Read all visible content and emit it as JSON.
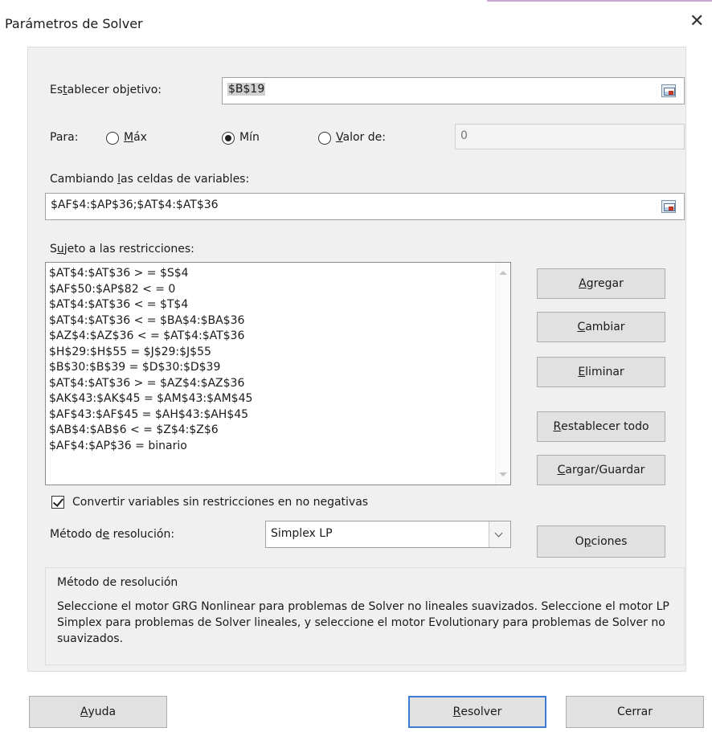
{
  "window": {
    "title": "Parámetros de Solver",
    "close_label": "✕"
  },
  "objective": {
    "label_pre": "Es",
    "label_accel": "t",
    "label_post": "ablecer objetivo:",
    "value": "$B$19"
  },
  "para": {
    "label": "Para:",
    "max": {
      "accel": "M",
      "rest": "áx",
      "selected": false
    },
    "min": {
      "label": "Mín",
      "selected": true
    },
    "value_of": {
      "accel": "V",
      "rest": "alor de:",
      "selected": false
    },
    "value_input": "0"
  },
  "variables": {
    "label_pre": "Cambiando ",
    "label_accel": "l",
    "label_post": "as celdas de variables:",
    "value": "$AF$4:$AP$36;$AT$4:$AT$36"
  },
  "constraints": {
    "label_pre": "S",
    "label_accel": "u",
    "label_post": "jeto a las restricciones:",
    "items": [
      "$AT$4:$AT$36 > = $S$4",
      "$AF$50:$AP$82 < = 0",
      "$AT$4:$AT$36 < = $T$4",
      "$AT$4:$AT$36 < = $BA$4:$BA$36",
      "$AZ$4:$AZ$36 < = $AT$4:$AT$36",
      "$H$29:$H$55 = $J$29:$J$55",
      "$B$30:$B$39 = $D$30:$D$39",
      "$AT$4:$AT$36 > = $AZ$4:$AZ$36",
      "$AK$43:$AK$45 = $AM$43:$AM$45",
      "$AF$43:$AF$45 = $AH$43:$AH$45",
      "$AB$4:$AB$6 < = $Z$4:$Z$6",
      "$AF$4:$AP$36 = binario"
    ]
  },
  "side_buttons": {
    "agregar": {
      "accel": "A",
      "rest": "gregar"
    },
    "cambiar": {
      "accel": "C",
      "rest": "ambiar"
    },
    "eliminar": {
      "accel": "E",
      "rest": "liminar"
    },
    "restablecer": {
      "accel": "R",
      "rest": "establecer todo"
    },
    "cargar": {
      "accel": "C",
      "rest": "argar/Guardar"
    }
  },
  "nonneg": {
    "checked": true,
    "label": "Convertir variables sin restricciones en no negativas"
  },
  "method": {
    "label_pre": "Método d",
    "label_accel": "e",
    "label_post": " resolución:",
    "value": "Simplex LP"
  },
  "options_button": {
    "pre": "O",
    "accel": "p",
    "post": "ciones"
  },
  "method_group": {
    "title": "Método de resolución",
    "text": "Seleccione el motor GRG Nonlinear para problemas de Solver no lineales suavizados. Seleccione el motor LP Simplex para problemas de Solver lineales, y seleccione el motor Evolutionary para problemas de Solver no suavizados."
  },
  "footer": {
    "help": {
      "accel": "A",
      "rest": "yuda"
    },
    "solve": {
      "accel": "R",
      "rest": "esolver"
    },
    "close": "Cerrar"
  }
}
